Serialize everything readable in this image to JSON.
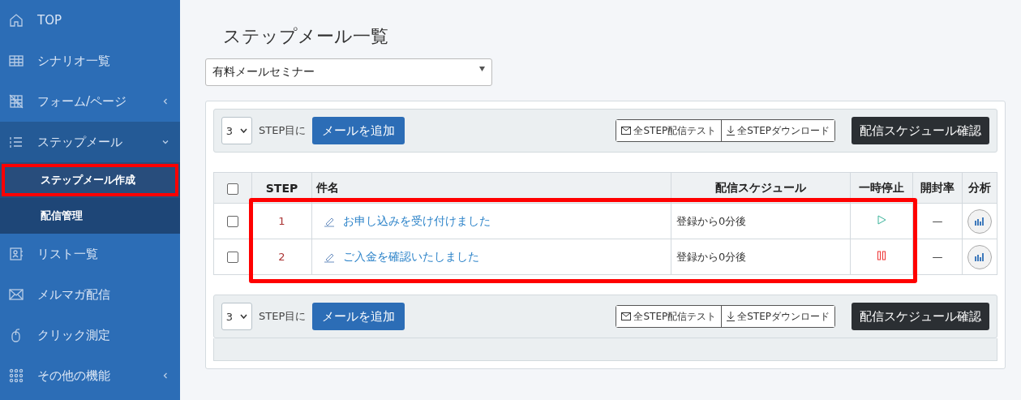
{
  "sidebar": {
    "items": [
      {
        "label": "TOP",
        "expandable": false,
        "expanded": false
      },
      {
        "label": "シナリオ一覧",
        "expandable": false,
        "expanded": false
      },
      {
        "label": "フォーム/ページ",
        "expandable": true,
        "expanded": false
      },
      {
        "label": "ステップメール",
        "expandable": true,
        "expanded": true,
        "children": [
          {
            "label": "ステップメール作成",
            "highlighted": true
          },
          {
            "label": "配信管理",
            "highlighted": false
          }
        ]
      },
      {
        "label": "リスト一覧",
        "expandable": false,
        "expanded": false
      },
      {
        "label": "メルマガ配信",
        "expandable": false,
        "expanded": false
      },
      {
        "label": "クリック測定",
        "expandable": false,
        "expanded": false
      },
      {
        "label": "その他の機能",
        "expandable": true,
        "expanded": false
      }
    ]
  },
  "page_title": "ステップメール一覧",
  "scenario_select": {
    "value": "有料メールセミナー"
  },
  "toolbars": [
    {
      "step_select": "3",
      "step_label": "STEP目に",
      "add_button": "メールを追加",
      "test_button": "全STEP配信テスト",
      "download_button": "全STEPダウンロード",
      "schedule_button": "配信スケジュール確認"
    },
    {
      "step_select": "3",
      "step_label": "STEP目に",
      "add_button": "メールを追加",
      "test_button": "全STEP配信テスト",
      "download_button": "全STEPダウンロード",
      "schedule_button": "配信スケジュール確認"
    }
  ],
  "table": {
    "highlighted": true,
    "all_checked": false,
    "columns": [
      "STEP",
      "件名",
      "配信スケジュール",
      "一時停止",
      "開封率",
      "分析"
    ],
    "rows": [
      {
        "checked": false,
        "step": "1",
        "subject": "お申し込みを受け付けました",
        "schedule": "登録から0分後",
        "paused": false,
        "open_rate": "—"
      },
      {
        "checked": false,
        "step": "2",
        "subject": "ご入金を確認いたしました",
        "schedule": "登録から0分後",
        "paused": true,
        "open_rate": "—"
      }
    ]
  }
}
